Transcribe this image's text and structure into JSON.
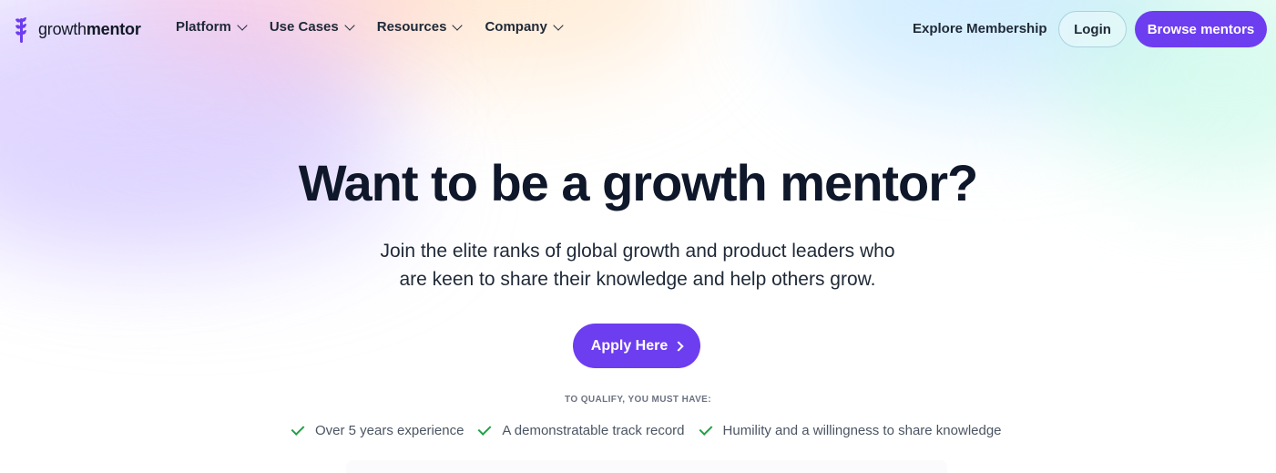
{
  "brand": {
    "name_regular": "growth",
    "name_bold": "mentor",
    "accent_color": "#6d3df0"
  },
  "nav": {
    "items": [
      {
        "label": "Platform",
        "icon": "chevron-down-icon"
      },
      {
        "label": "Use Cases",
        "icon": "chevron-down-icon"
      },
      {
        "label": "Resources",
        "icon": "chevron-down-icon"
      },
      {
        "label": "Company",
        "icon": "chevron-down-icon"
      }
    ],
    "explore_label": "Explore Membership",
    "login_label": "Login",
    "browse_label": "Browse mentors"
  },
  "hero": {
    "headline": "Want to be a growth mentor?",
    "subtitle_line1": "Join the elite ranks of global growth and product leaders who",
    "subtitle_line2": "are keen to share their knowledge and help others grow.",
    "apply_label": "Apply Here",
    "qualify_heading": "TO QUALIFY, YOU MUST HAVE:",
    "requirements": [
      "Over 5 years experience",
      "A demonstratable track record",
      "Humility and a willingness to share knowledge"
    ],
    "check_color": "#22a046"
  }
}
